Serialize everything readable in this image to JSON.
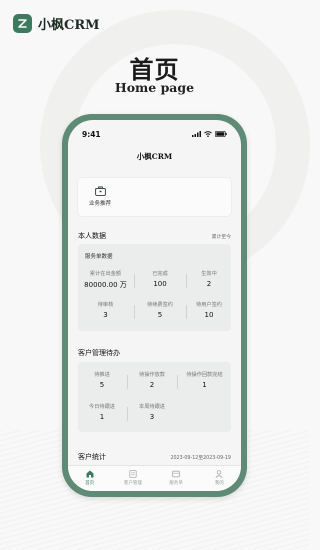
{
  "brand": {
    "name": "小枫CRM"
  },
  "hero": {
    "title": "首页",
    "subtitle": "Home page"
  },
  "phone": {
    "status_time": "9:41",
    "app_title": "小枫CRM",
    "business": {
      "label": "业务推荐",
      "icon": "briefcase-icon"
    },
    "personal": {
      "title": "本人数据",
      "extra": "累计至今",
      "panel_title": "服务单数据",
      "row1": [
        {
          "label": "累计在出金额",
          "value": "80000.00 万"
        },
        {
          "label": "已完成",
          "value": "100"
        },
        {
          "label": "生效中",
          "value": "2"
        }
      ],
      "row2": [
        {
          "label": "待审核",
          "value": "3"
        },
        {
          "label": "待续费签约",
          "value": "5"
        },
        {
          "label": "待用户签约",
          "value": "10"
        }
      ]
    },
    "todo": {
      "title": "客户管理待办",
      "row1": [
        {
          "label": "待推进",
          "value": "5"
        },
        {
          "label": "待操作放款",
          "value": "2"
        },
        {
          "label": "待操作回款完结",
          "value": "1"
        }
      ],
      "row2": [
        {
          "label": "今日待跟进",
          "value": "1"
        },
        {
          "label": "本周待跟进",
          "value": "3"
        }
      ]
    },
    "stats": {
      "title": "客户统计",
      "date_range": "2023-09-12至2023-09-19"
    },
    "tabs": [
      {
        "label": "首页",
        "icon": "home-icon",
        "active": true
      },
      {
        "label": "客户管理",
        "icon": "clients-icon",
        "active": false
      },
      {
        "label": "服务单",
        "icon": "orders-icon",
        "active": false
      },
      {
        "label": "我的",
        "icon": "profile-icon",
        "active": false
      }
    ]
  }
}
